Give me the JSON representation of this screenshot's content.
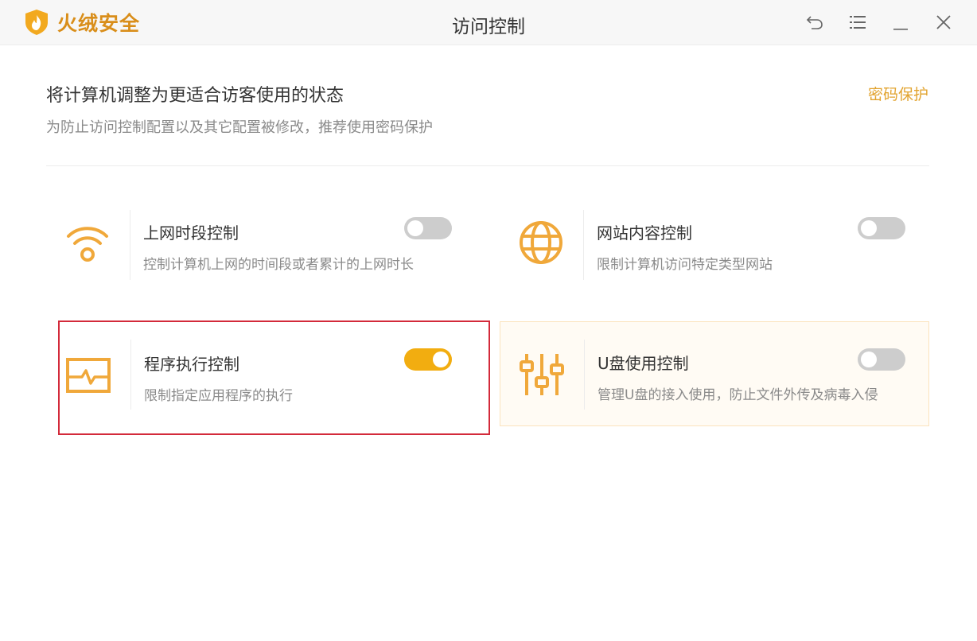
{
  "app": {
    "brand_name": "火绒安全",
    "window_title": "访问控制",
    "accent_color": "#e2a32e",
    "toggle_on_color": "#f2ad10",
    "selection_border_color": "#d32a3a"
  },
  "window_controls": [
    {
      "icon": "back-arrow-icon"
    },
    {
      "icon": "menu-list-icon"
    },
    {
      "icon": "minimize-icon"
    },
    {
      "icon": "close-icon"
    }
  ],
  "header": {
    "headline": "将计算机调整为更适合访客使用的状态",
    "subline": "为防止访问控制配置以及其它配置被修改，推荐使用密码保护",
    "password_link": "密码保护"
  },
  "cards": [
    {
      "title": "上网时段控制",
      "description": "控制计算机上网的时间段或者累计的上网时长",
      "icon": "wifi-icon",
      "enabled": false
    },
    {
      "title": "网站内容控制",
      "description": "限制计算机访问特定类型网站",
      "icon": "globe-icon",
      "enabled": false
    },
    {
      "title": "程序执行控制",
      "description": "限制指定应用程序的执行",
      "icon": "program-monitor-icon",
      "enabled": true,
      "selected": true
    },
    {
      "title": "U盘使用控制",
      "description": "管理U盘的接入使用，防止文件外传及病毒入侵",
      "icon": "sliders-icon",
      "enabled": false,
      "hovered": true
    }
  ]
}
